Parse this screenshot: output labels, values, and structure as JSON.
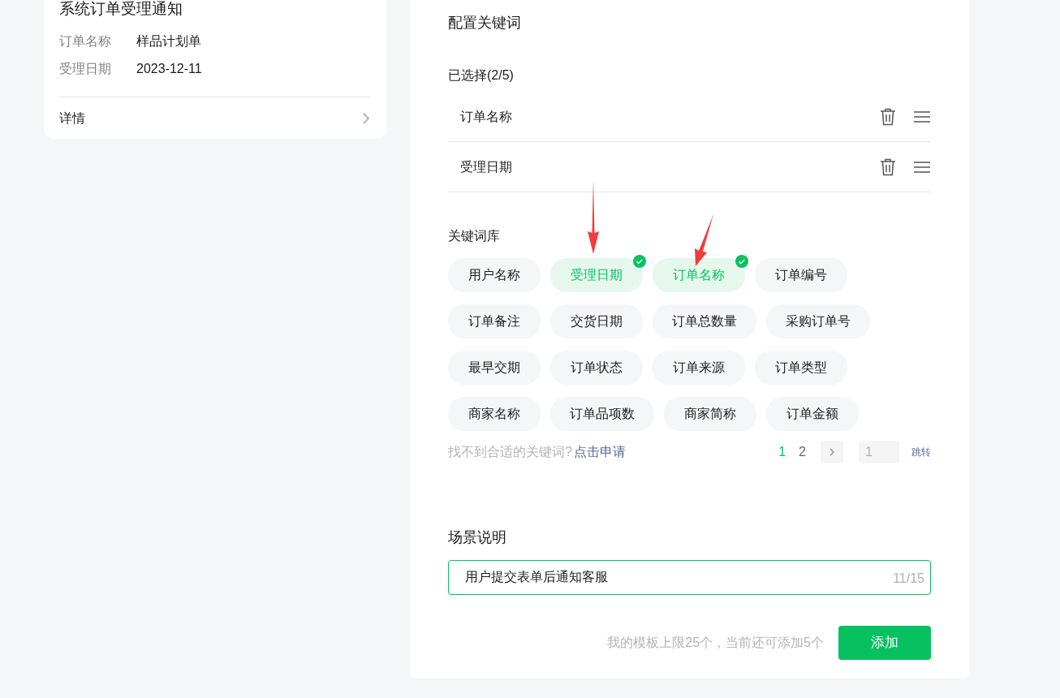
{
  "preview": {
    "title": "系统订单受理通知",
    "fields": [
      {
        "label": "订单名称",
        "value": "样品计划单"
      },
      {
        "label": "受理日期",
        "value": "2023-12-11"
      }
    ],
    "details_link": "详情"
  },
  "config": {
    "title": "配置关键词",
    "selected_heading": "已选择(2/5)",
    "selected": [
      {
        "label": "订单名称"
      },
      {
        "label": "受理日期"
      }
    ],
    "library_heading": "关键词库",
    "keywords": [
      {
        "label": "用户名称",
        "selected": false
      },
      {
        "label": "受理日期",
        "selected": true
      },
      {
        "label": "订单名称",
        "selected": true
      },
      {
        "label": "订单编号",
        "selected": false
      },
      {
        "label": "订单备注",
        "selected": false
      },
      {
        "label": "交货日期",
        "selected": false
      },
      {
        "label": "订单总数量",
        "selected": false
      },
      {
        "label": "采购订单号",
        "selected": false
      },
      {
        "label": "最早交期",
        "selected": false
      },
      {
        "label": "订单状态",
        "selected": false
      },
      {
        "label": "订单来源",
        "selected": false
      },
      {
        "label": "订单类型",
        "selected": false
      },
      {
        "label": "商家名称",
        "selected": false
      },
      {
        "label": "订单品项数",
        "selected": false
      },
      {
        "label": "商家简称",
        "selected": false
      },
      {
        "label": "订单金额",
        "selected": false
      }
    ],
    "hint": "找不到合适的关键词?",
    "apply_link": "点击申请",
    "pages": [
      {
        "label": "1",
        "selected": true
      },
      {
        "label": "2",
        "selected": false
      }
    ],
    "jump_placeholder": "1",
    "jump_label": "跳转"
  },
  "scene": {
    "title": "场景说明",
    "value": "用户提交表单后通知客服",
    "counter": "11/15"
  },
  "footer": {
    "quota": "我的模板上限25个，当前还可添加5个",
    "add_button": "添加"
  }
}
